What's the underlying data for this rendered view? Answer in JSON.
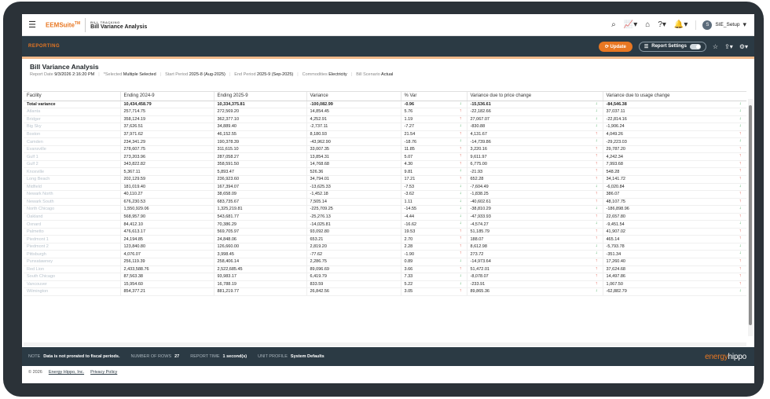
{
  "app": {
    "brand": "EEMSuite",
    "brand_tm": "TM",
    "section_small": "BILL TRACKING",
    "page_title": "Bill Variance Analysis",
    "user": "SIE_Setup",
    "avatar_letter": "S"
  },
  "reportbar": {
    "label": "REPORTING",
    "update_label": "Update",
    "settings_label": "Report Settings"
  },
  "report": {
    "title": "Bill Variance Analysis",
    "meta": [
      {
        "label": "Report Date",
        "value": "9/3/2026 2:16:20 PM"
      },
      {
        "label": "*Selected",
        "value": "Multiple Selected"
      },
      {
        "label": "Start Period",
        "value": "2025-8 (Aug-2025)"
      },
      {
        "label": "End Period",
        "value": "2025-9 (Sep-2025)"
      },
      {
        "label": "Commodities",
        "value": "Electricity"
      },
      {
        "label": "Bill Scenario",
        "value": "Actual"
      }
    ]
  },
  "table": {
    "headers": [
      "Facility",
      "Ending 2024-9",
      "Ending 2025-9",
      "Variance",
      "% Var",
      "Variance due to price change",
      "Variance due to usage change"
    ],
    "total": {
      "name": "Total variance",
      "e24": "10,434,458.79",
      "e25": "10,334,375.81",
      "var": "-100,082.99",
      "pct": "-0.96",
      "price": "-15,536.61",
      "price_dir": "down",
      "usage": "-84,546.38",
      "usage_dir": "down"
    },
    "rows": [
      {
        "name": "Atlanta",
        "e24": "257,714.75",
        "e25": "272,569.20",
        "var": "14,854.45",
        "pct": "5.76",
        "price": "-22,182.66",
        "price_dir": "up",
        "usage": "37,037.11",
        "usage_dir": "down"
      },
      {
        "name": "Bridger",
        "e24": "358,124.19",
        "e25": "362,377.10",
        "var": "4,252.91",
        "pct": "1.19",
        "price": "27,067.07",
        "price_dir": "up",
        "usage": "-22,814.16",
        "usage_dir": "down"
      },
      {
        "name": "Big Sky",
        "e24": "37,626.51",
        "e25": "34,889.40",
        "var": "-2,737.11",
        "pct": "-7.27",
        "price": "-830.88",
        "price_dir": "down",
        "usage": "-1,906.24",
        "usage_dir": "down"
      },
      {
        "name": "Boston",
        "e24": "37,971.62",
        "e25": "46,152.55",
        "var": "8,180.93",
        "pct": "21.54",
        "price": "4,131.67",
        "price_dir": "up",
        "usage": "4,049.26",
        "usage_dir": "up"
      },
      {
        "name": "Camden",
        "e24": "234,341.29",
        "e25": "190,378.39",
        "var": "-43,962.90",
        "pct": "-18.76",
        "price": "-14,739.86",
        "price_dir": "down",
        "usage": "-29,223.03",
        "usage_dir": "down"
      },
      {
        "name": "Evansville",
        "e24": "278,607.75",
        "e25": "311,615.10",
        "var": "33,007.35",
        "pct": "11.85",
        "price": "3,220.16",
        "price_dir": "up",
        "usage": "29,787.20",
        "usage_dir": "up"
      },
      {
        "name": "Gulf 1",
        "e24": "273,203.96",
        "e25": "287,058.27",
        "var": "13,854.31",
        "pct": "5.07",
        "price": "9,611.97",
        "price_dir": "up",
        "usage": "4,242.34",
        "usage_dir": "up"
      },
      {
        "name": "Gulf 2",
        "e24": "343,822.82",
        "e25": "358,591.50",
        "var": "14,768.68",
        "pct": "4.30",
        "price": "6,775.00",
        "price_dir": "up",
        "usage": "7,993.68",
        "usage_dir": "up"
      },
      {
        "name": "Knoxville",
        "e24": "5,367.11",
        "e25": "5,893.47",
        "var": "526.36",
        "pct": "9.81",
        "price": "-21.93",
        "price_dir": "down",
        "usage": "548.28",
        "usage_dir": "up"
      },
      {
        "name": "Long Beach",
        "e24": "202,129.59",
        "e25": "236,923.60",
        "var": "34,794.01",
        "pct": "17.21",
        "price": "652.28",
        "price_dir": "up",
        "usage": "34,141.72",
        "usage_dir": "up"
      },
      {
        "name": "Midfield",
        "e24": "181,019.40",
        "e25": "167,394.07",
        "var": "-13,625.33",
        "pct": "-7.53",
        "price": "-7,604.49",
        "price_dir": "down",
        "usage": "-6,020.84",
        "usage_dir": "down"
      },
      {
        "name": "Newark North",
        "e24": "40,110.27",
        "e25": "38,658.09",
        "var": "-1,452.18",
        "pct": "-3.62",
        "price": "-1,838.25",
        "price_dir": "down",
        "usage": "386.07",
        "usage_dir": "up"
      },
      {
        "name": "Newark South",
        "e24": "676,230.53",
        "e25": "683,735.67",
        "var": "7,505.14",
        "pct": "1.11",
        "price": "-40,602.61",
        "price_dir": "down",
        "usage": "48,107.75",
        "usage_dir": "up"
      },
      {
        "name": "North Chicago",
        "e24": "1,550,929.06",
        "e25": "1,325,219.81",
        "var": "-225,709.25",
        "pct": "-14.55",
        "price": "-38,810.29",
        "price_dir": "down",
        "usage": "-186,898.96",
        "usage_dir": "down"
      },
      {
        "name": "Oakland",
        "e24": "568,957.90",
        "e25": "543,681.77",
        "var": "-25,276.13",
        "pct": "-4.44",
        "price": "-47,933.93",
        "price_dir": "down",
        "usage": "22,657.80",
        "usage_dir": "up"
      },
      {
        "name": "Oxnard",
        "e24": "84,412.10",
        "e25": "70,386.29",
        "var": "-14,025.81",
        "pct": "-16.62",
        "price": "-4,574.27",
        "price_dir": "down",
        "usage": "-9,451.54",
        "usage_dir": "down"
      },
      {
        "name": "Palmetto",
        "e24": "476,613.17",
        "e25": "569,705.97",
        "var": "93,092.80",
        "pct": "19.53",
        "price": "51,185.79",
        "price_dir": "up",
        "usage": "41,907.02",
        "usage_dir": "up"
      },
      {
        "name": "Piedmont 1",
        "e24": "24,194.85",
        "e25": "24,848.06",
        "var": "653.21",
        "pct": "2.70",
        "price": "188.07",
        "price_dir": "up",
        "usage": "465.14",
        "usage_dir": "up"
      },
      {
        "name": "Piedmont 2",
        "e24": "123,840.80",
        "e25": "126,660.00",
        "var": "2,819.20",
        "pct": "2.28",
        "price": "8,612.98",
        "price_dir": "up",
        "usage": "-5,793.78",
        "usage_dir": "down"
      },
      {
        "name": "Pittsburgh",
        "e24": "4,076.07",
        "e25": "3,998.45",
        "var": "-77.62",
        "pct": "-1.90",
        "price": "273.72",
        "price_dir": "up",
        "usage": "-351.34",
        "usage_dir": "down"
      },
      {
        "name": "Punxatawney",
        "e24": "256,119.39",
        "e25": "258,406.14",
        "var": "2,286.75",
        "pct": "0.89",
        "price": "-14,973.64",
        "price_dir": "down",
        "usage": "17,260.40",
        "usage_dir": "up"
      },
      {
        "name": "Red Lion",
        "e24": "2,433,588.76",
        "e25": "2,522,685.45",
        "var": "89,096.69",
        "pct": "3.66",
        "price": "51,472.01",
        "price_dir": "up",
        "usage": "37,624.68",
        "usage_dir": "up"
      },
      {
        "name": "South Chicago",
        "e24": "87,563.38",
        "e25": "93,983.17",
        "var": "6,419.79",
        "pct": "7.33",
        "price": "-8,078.07",
        "price_dir": "down",
        "usage": "14,497.86",
        "usage_dir": "up"
      },
      {
        "name": "Vancouver",
        "e24": "15,954.60",
        "e25": "16,788.19",
        "var": "833.59",
        "pct": "5.22",
        "price": "-233.91",
        "price_dir": "down",
        "usage": "1,067.50",
        "usage_dir": "up"
      },
      {
        "name": "Wilmington",
        "e24": "854,377.21",
        "e25": "881,219.77",
        "var": "26,842.56",
        "pct": "3.05",
        "price": "89,865.36",
        "price_dir": "up",
        "usage": "-62,882.79",
        "usage_dir": "down"
      }
    ]
  },
  "footer": {
    "note_label": "NOTE",
    "note_value": "Data is not prorated to fiscal periods.",
    "rows_label": "NUMBER OF ROWS",
    "rows_value": "27",
    "time_label": "REPORT TIME",
    "time_value": "1 second(s)",
    "profile_label": "UNIT PROFILE",
    "profile_value": "System Defaults",
    "logo": "energyhippo"
  },
  "copyright": {
    "text": "© 2026",
    "company": "Energy Hippo, Inc.",
    "policy": "Privacy Policy"
  },
  "colors": {
    "accent": "#e87722",
    "dark": "#2b3a44",
    "up": "#d9412e",
    "down": "#2e9e4a"
  }
}
